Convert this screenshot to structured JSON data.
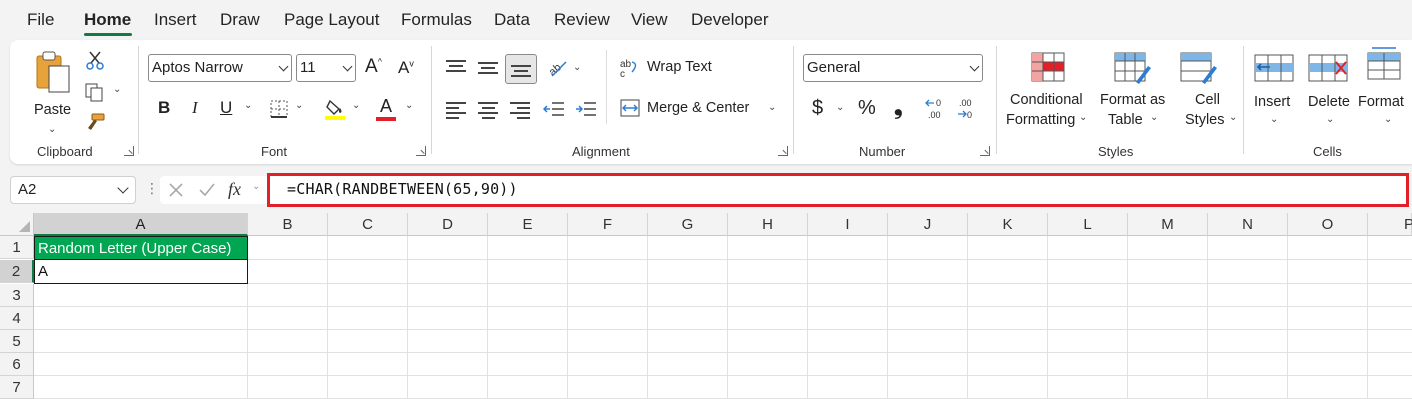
{
  "tabs": [
    "File",
    "Home",
    "Insert",
    "Draw",
    "Page Layout",
    "Formulas",
    "Data",
    "Review",
    "View",
    "Developer"
  ],
  "active_tab": "Home",
  "clipboard": {
    "paste_label": "Paste",
    "group_label": "Clipboard"
  },
  "font": {
    "name": "Aptos Narrow",
    "size": "11",
    "bold": "B",
    "italic": "I",
    "underline": "U",
    "font_color_letter": "A",
    "grow": "A",
    "shrink": "A",
    "group_label": "Font",
    "highlight_color": "#ffff00",
    "font_color": "#e3202a"
  },
  "alignment": {
    "wrap_text": "Wrap Text",
    "merge_center": "Merge & Center",
    "group_label": "Alignment"
  },
  "number": {
    "format": "General",
    "currency": "$",
    "percent": "%",
    "comma": "❟",
    "inc_decimal": "←0 .00",
    "dec_decimal": ".00 →0",
    "group_label": "Number"
  },
  "styles": {
    "conditional_line1": "Conditional",
    "conditional_line2": "Formatting",
    "format_table_line1": "Format as",
    "format_table_line2": "Table",
    "cell_styles_line1": "Cell",
    "cell_styles_line2": "Styles",
    "group_label": "Styles"
  },
  "cells": {
    "insert": "Insert",
    "delete": "Delete",
    "format": "Format",
    "group_label": "Cells"
  },
  "formula_bar": {
    "name_box": "A2",
    "fx": "fx",
    "formula": "=CHAR(RANDBETWEEN(65,90))"
  },
  "grid": {
    "columns": [
      "A",
      "B",
      "C",
      "D",
      "E",
      "F",
      "G",
      "H",
      "I",
      "J",
      "K",
      "L",
      "M",
      "N",
      "O",
      "P"
    ],
    "rows": [
      "1",
      "2",
      "3",
      "4",
      "5",
      "6",
      "7"
    ],
    "cells": {
      "A1": "Random Letter (Upper Case)",
      "A2": "A"
    }
  },
  "colors": {
    "accent": "#107c41",
    "header_fill": "#00a651",
    "highlight_border": "#e3202a"
  }
}
